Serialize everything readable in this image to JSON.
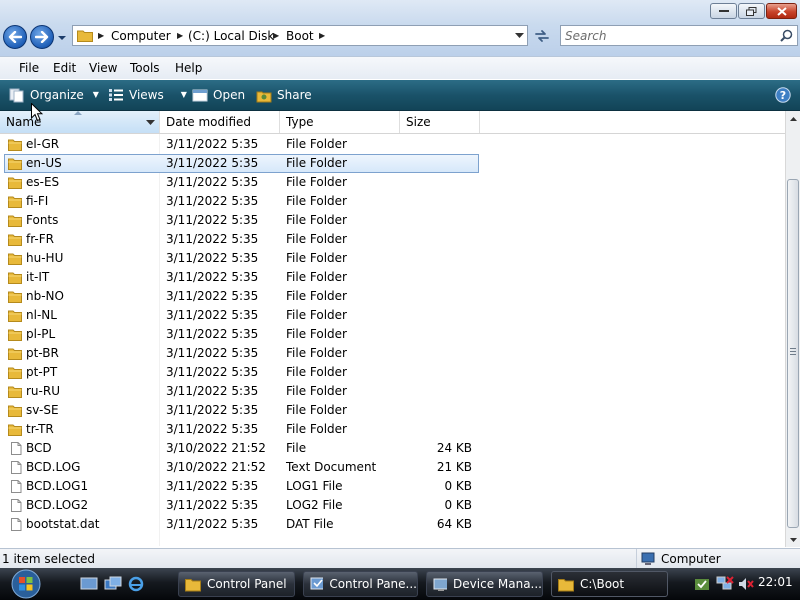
{
  "window": {
    "controls": {
      "minimize": "minimize",
      "maximize": "maximize",
      "close": "close"
    }
  },
  "address": {
    "crumbs": [
      "Computer",
      "(C:) Local Disk",
      "Boot"
    ]
  },
  "search": {
    "placeholder": "Search"
  },
  "menu": [
    "File",
    "Edit",
    "View",
    "Tools",
    "Help"
  ],
  "toolbar": {
    "organize": "Organize",
    "views": "Views",
    "open": "Open",
    "share": "Share"
  },
  "columns": {
    "name": "Name",
    "date": "Date modified",
    "type": "Type",
    "size": "Size"
  },
  "files": [
    {
      "name": "el-GR",
      "date": "3/11/2022 5:35",
      "type": "File Folder",
      "size": "",
      "kind": "folder"
    },
    {
      "name": "en-US",
      "date": "3/11/2022 5:35",
      "type": "File Folder",
      "size": "",
      "kind": "folder",
      "selected": true
    },
    {
      "name": "es-ES",
      "date": "3/11/2022 5:35",
      "type": "File Folder",
      "size": "",
      "kind": "folder"
    },
    {
      "name": "fi-FI",
      "date": "3/11/2022 5:35",
      "type": "File Folder",
      "size": "",
      "kind": "folder"
    },
    {
      "name": "Fonts",
      "date": "3/11/2022 5:35",
      "type": "File Folder",
      "size": "",
      "kind": "folder"
    },
    {
      "name": "fr-FR",
      "date": "3/11/2022 5:35",
      "type": "File Folder",
      "size": "",
      "kind": "folder"
    },
    {
      "name": "hu-HU",
      "date": "3/11/2022 5:35",
      "type": "File Folder",
      "size": "",
      "kind": "folder"
    },
    {
      "name": "it-IT",
      "date": "3/11/2022 5:35",
      "type": "File Folder",
      "size": "",
      "kind": "folder"
    },
    {
      "name": "nb-NO",
      "date": "3/11/2022 5:35",
      "type": "File Folder",
      "size": "",
      "kind": "folder"
    },
    {
      "name": "nl-NL",
      "date": "3/11/2022 5:35",
      "type": "File Folder",
      "size": "",
      "kind": "folder"
    },
    {
      "name": "pl-PL",
      "date": "3/11/2022 5:35",
      "type": "File Folder",
      "size": "",
      "kind": "folder"
    },
    {
      "name": "pt-BR",
      "date": "3/11/2022 5:35",
      "type": "File Folder",
      "size": "",
      "kind": "folder"
    },
    {
      "name": "pt-PT",
      "date": "3/11/2022 5:35",
      "type": "File Folder",
      "size": "",
      "kind": "folder"
    },
    {
      "name": "ru-RU",
      "date": "3/11/2022 5:35",
      "type": "File Folder",
      "size": "",
      "kind": "folder"
    },
    {
      "name": "sv-SE",
      "date": "3/11/2022 5:35",
      "type": "File Folder",
      "size": "",
      "kind": "folder"
    },
    {
      "name": "tr-TR",
      "date": "3/11/2022 5:35",
      "type": "File Folder",
      "size": "",
      "kind": "folder"
    },
    {
      "name": "BCD",
      "date": "3/10/2022 21:52",
      "type": "File",
      "size": "24 KB",
      "kind": "file"
    },
    {
      "name": "BCD.LOG",
      "date": "3/10/2022 21:52",
      "type": "Text Document",
      "size": "21 KB",
      "kind": "file"
    },
    {
      "name": "BCD.LOG1",
      "date": "3/11/2022 5:35",
      "type": "LOG1 File",
      "size": "0 KB",
      "kind": "file"
    },
    {
      "name": "BCD.LOG2",
      "date": "3/11/2022 5:35",
      "type": "LOG2 File",
      "size": "0 KB",
      "kind": "file"
    },
    {
      "name": "bootstat.dat",
      "date": "3/11/2022 5:35",
      "type": "DAT File",
      "size": "64 KB",
      "kind": "file"
    }
  ],
  "status": {
    "selection": "1 item selected",
    "zone": "Computer"
  },
  "taskbar": {
    "buttons": [
      {
        "label": "Control Panel",
        "icon": "folder-icon"
      },
      {
        "label": "Control Pane...",
        "icon": "control-panel-icon"
      },
      {
        "label": "Device Mana...",
        "icon": "device-manager-icon"
      },
      {
        "label": "C:\\Boot",
        "icon": "folder-icon",
        "active": true
      }
    ],
    "clock": "22:01"
  },
  "colors": {
    "toolbar": "#1a5269",
    "selection_border": "#7da2ce",
    "selection_fill": "#d6e8fa",
    "folder": "#e8b93a"
  }
}
